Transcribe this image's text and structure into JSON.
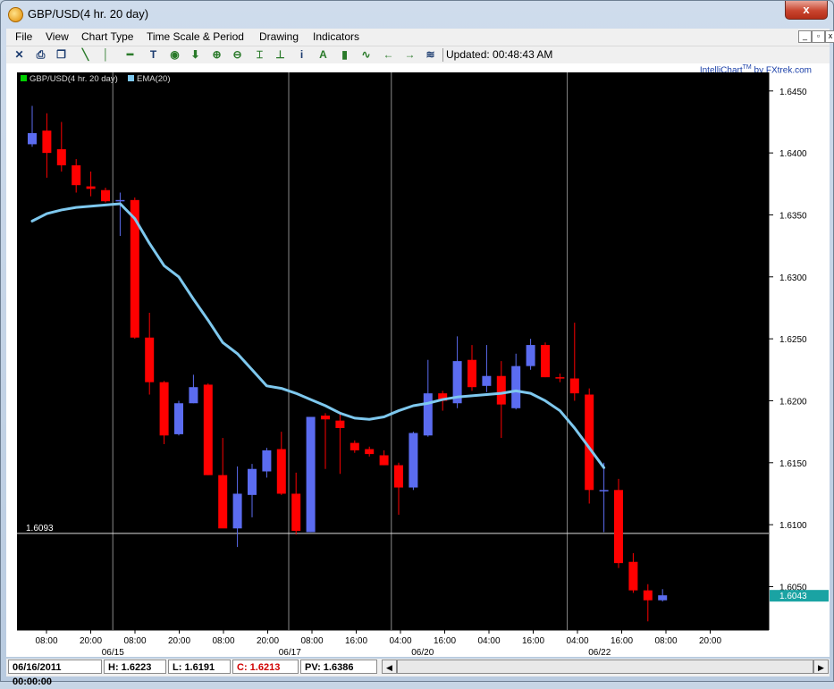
{
  "window": {
    "title": "GBP/USD(4 hr.  20 day)",
    "close_label": "x"
  },
  "menu": {
    "items": [
      "File",
      "View",
      "Chart Type",
      "Time Scale & Period",
      "Drawing",
      "Indicators"
    ]
  },
  "toolbar": {
    "icons": [
      "crosshair-icon",
      "print-icon",
      "copy-icon",
      "trendline-icon",
      "vertical-line-icon",
      "horizontal-line-icon",
      "text-icon",
      "circle-icon",
      "arrow-down-icon",
      "zoom-in-icon",
      "zoom-out-icon",
      "fit-icon",
      "baseline-icon",
      "info-icon",
      "font-icon",
      "bar-chart-icon",
      "wave-icon",
      "arrow-left-icon",
      "arrow-right-icon",
      "scroll-toggle-icon"
    ],
    "updated_text": "Updated: 00:48:43 AM"
  },
  "brand": {
    "name": "IntelliChart",
    "sup": "TM",
    "by": " by FXtrek.com"
  },
  "colors": {
    "up": "#5b6cf0",
    "down": "#ff0000",
    "ema": "#7ec8ee",
    "background": "#000000",
    "last_price_bg": "#1aa3a3"
  },
  "chart_data": {
    "type": "candlestick",
    "legend": [
      {
        "name": "GBP/USD(4 hr.  20 day)",
        "color": "#00d000"
      },
      {
        "name": "EMA(20)",
        "color": "#7ec8ee"
      }
    ],
    "ylim": [
      1.6015,
      1.6465
    ],
    "y_ticks": [
      "1.6450",
      "1.6400",
      "1.6350",
      "1.6300",
      "1.6250",
      "1.6200",
      "1.6150",
      "1.6100",
      "1.6050"
    ],
    "x_ticks": [
      "08:00",
      "20:00",
      "08:00",
      "20:00",
      "08:00",
      "20:00",
      "08:00",
      "16:00",
      "04:00",
      "16:00",
      "04:00",
      "16:00",
      "04:00",
      "16:00",
      "08:00",
      "20:00"
    ],
    "date_labels": [
      {
        "label": "06/15",
        "after_tick": 1
      },
      {
        "label": "06/17",
        "after_tick": 5
      },
      {
        "label": "06/20",
        "after_tick": 8
      },
      {
        "label": "06/22",
        "after_tick": 12
      }
    ],
    "separators_after_candle": [
      5,
      17,
      24,
      36
    ],
    "horizontal_line": {
      "value": 1.6093,
      "label": "1.6093"
    },
    "last_price": "1.6043",
    "candles": [
      {
        "o": 1.6407,
        "h": 1.6438,
        "l": 1.6405,
        "c": 1.6416
      },
      {
        "o": 1.6418,
        "h": 1.6432,
        "l": 1.638,
        "c": 1.64
      },
      {
        "o": 1.6403,
        "h": 1.6425,
        "l": 1.6385,
        "c": 1.639
      },
      {
        "o": 1.639,
        "h": 1.6395,
        "l": 1.6368,
        "c": 1.6374
      },
      {
        "o": 1.6373,
        "h": 1.6385,
        "l": 1.6365,
        "c": 1.6371
      },
      {
        "o": 1.637,
        "h": 1.6372,
        "l": 1.636,
        "c": 1.6361
      },
      {
        "o": 1.6362,
        "h": 1.6368,
        "l": 1.6333,
        "c": 1.6362
      },
      {
        "o": 1.6362,
        "h": 1.6364,
        "l": 1.625,
        "c": 1.6251
      },
      {
        "o": 1.6251,
        "h": 1.6271,
        "l": 1.6205,
        "c": 1.6215
      },
      {
        "o": 1.6215,
        "h": 1.6216,
        "l": 1.6165,
        "c": 1.6172
      },
      {
        "o": 1.6173,
        "h": 1.62,
        "l": 1.6172,
        "c": 1.6198
      },
      {
        "o": 1.6198,
        "h": 1.6221,
        "l": 1.6198,
        "c": 1.6211
      },
      {
        "o": 1.6213,
        "h": 1.6214,
        "l": 1.614,
        "c": 1.614
      },
      {
        "o": 1.614,
        "h": 1.617,
        "l": 1.6098,
        "c": 1.6097
      },
      {
        "o": 1.6097,
        "h": 1.6147,
        "l": 1.6082,
        "c": 1.6125
      },
      {
        "o": 1.6124,
        "h": 1.6149,
        "l": 1.6106,
        "c": 1.6145
      },
      {
        "o": 1.6143,
        "h": 1.6162,
        "l": 1.6138,
        "c": 1.616
      },
      {
        "o": 1.6161,
        "h": 1.6175,
        "l": 1.6124,
        "c": 1.6125
      },
      {
        "o": 1.6125,
        "h": 1.6142,
        "l": 1.6092,
        "c": 1.6095
      },
      {
        "o": 1.6094,
        "h": 1.6187,
        "l": 1.6094,
        "c": 1.6187
      },
      {
        "o": 1.6188,
        "h": 1.619,
        "l": 1.6145,
        "c": 1.6185
      },
      {
        "o": 1.6184,
        "h": 1.619,
        "l": 1.6141,
        "c": 1.6178
      },
      {
        "o": 1.6166,
        "h": 1.6168,
        "l": 1.6158,
        "c": 1.616
      },
      {
        "o": 1.6161,
        "h": 1.6163,
        "l": 1.6155,
        "c": 1.6157
      },
      {
        "o": 1.6156,
        "h": 1.616,
        "l": 1.6148,
        "c": 1.6148
      },
      {
        "o": 1.6148,
        "h": 1.615,
        "l": 1.6108,
        "c": 1.613
      },
      {
        "o": 1.613,
        "h": 1.6175,
        "l": 1.6128,
        "c": 1.6174
      },
      {
        "o": 1.6172,
        "h": 1.6233,
        "l": 1.6171,
        "c": 1.6206
      },
      {
        "o": 1.6206,
        "h": 1.6208,
        "l": 1.6192,
        "c": 1.62
      },
      {
        "o": 1.6198,
        "h": 1.6252,
        "l": 1.6194,
        "c": 1.6232
      },
      {
        "o": 1.6233,
        "h": 1.6245,
        "l": 1.6208,
        "c": 1.6211
      },
      {
        "o": 1.6212,
        "h": 1.6245,
        "l": 1.6207,
        "c": 1.622
      },
      {
        "o": 1.622,
        "h": 1.6232,
        "l": 1.617,
        "c": 1.6197
      },
      {
        "o": 1.6194,
        "h": 1.6238,
        "l": 1.6193,
        "c": 1.6228
      },
      {
        "o": 1.6228,
        "h": 1.625,
        "l": 1.6225,
        "c": 1.6245
      },
      {
        "o": 1.6245,
        "h": 1.6247,
        "l": 1.6219,
        "c": 1.6219
      },
      {
        "o": 1.6219,
        "h": 1.6222,
        "l": 1.6215,
        "c": 1.6218
      },
      {
        "o": 1.6218,
        "h": 1.6263,
        "l": 1.62,
        "c": 1.6206
      },
      {
        "o": 1.6205,
        "h": 1.621,
        "l": 1.6117,
        "c": 1.6128
      },
      {
        "o": 1.6128,
        "h": 1.615,
        "l": 1.6094,
        "c": 1.6128
      },
      {
        "o": 1.6128,
        "h": 1.6137,
        "l": 1.6065,
        "c": 1.6069
      },
      {
        "o": 1.607,
        "h": 1.6077,
        "l": 1.6045,
        "c": 1.6047
      },
      {
        "o": 1.6047,
        "h": 1.6052,
        "l": 1.6022,
        "c": 1.6039
      },
      {
        "o": 1.6039,
        "h": 1.6048,
        "l": 1.6038,
        "c": 1.6043
      }
    ],
    "ema": [
      1.6345,
      1.6351,
      1.6354,
      1.6356,
      1.6357,
      1.6358,
      1.6359,
      1.6347,
      1.6327,
      1.6309,
      1.63,
      1.6282,
      1.6265,
      1.6247,
      1.6238,
      1.6225,
      1.6212,
      1.621,
      1.6206,
      1.6201,
      1.6196,
      1.619,
      1.6186,
      1.6185,
      1.6187,
      1.6192,
      1.6196,
      1.6198,
      1.6201,
      1.6203,
      1.6204,
      1.6205,
      1.6206,
      1.6208,
      1.6206,
      1.62,
      1.6192,
      1.6178,
      1.6162,
      1.6146
    ]
  },
  "status": {
    "datetime": "06/16/2011 00:00:00",
    "high": "H: 1.6223",
    "low": "L: 1.6191",
    "close": "C: 1.6213",
    "pv": "PV: 1.6386"
  }
}
